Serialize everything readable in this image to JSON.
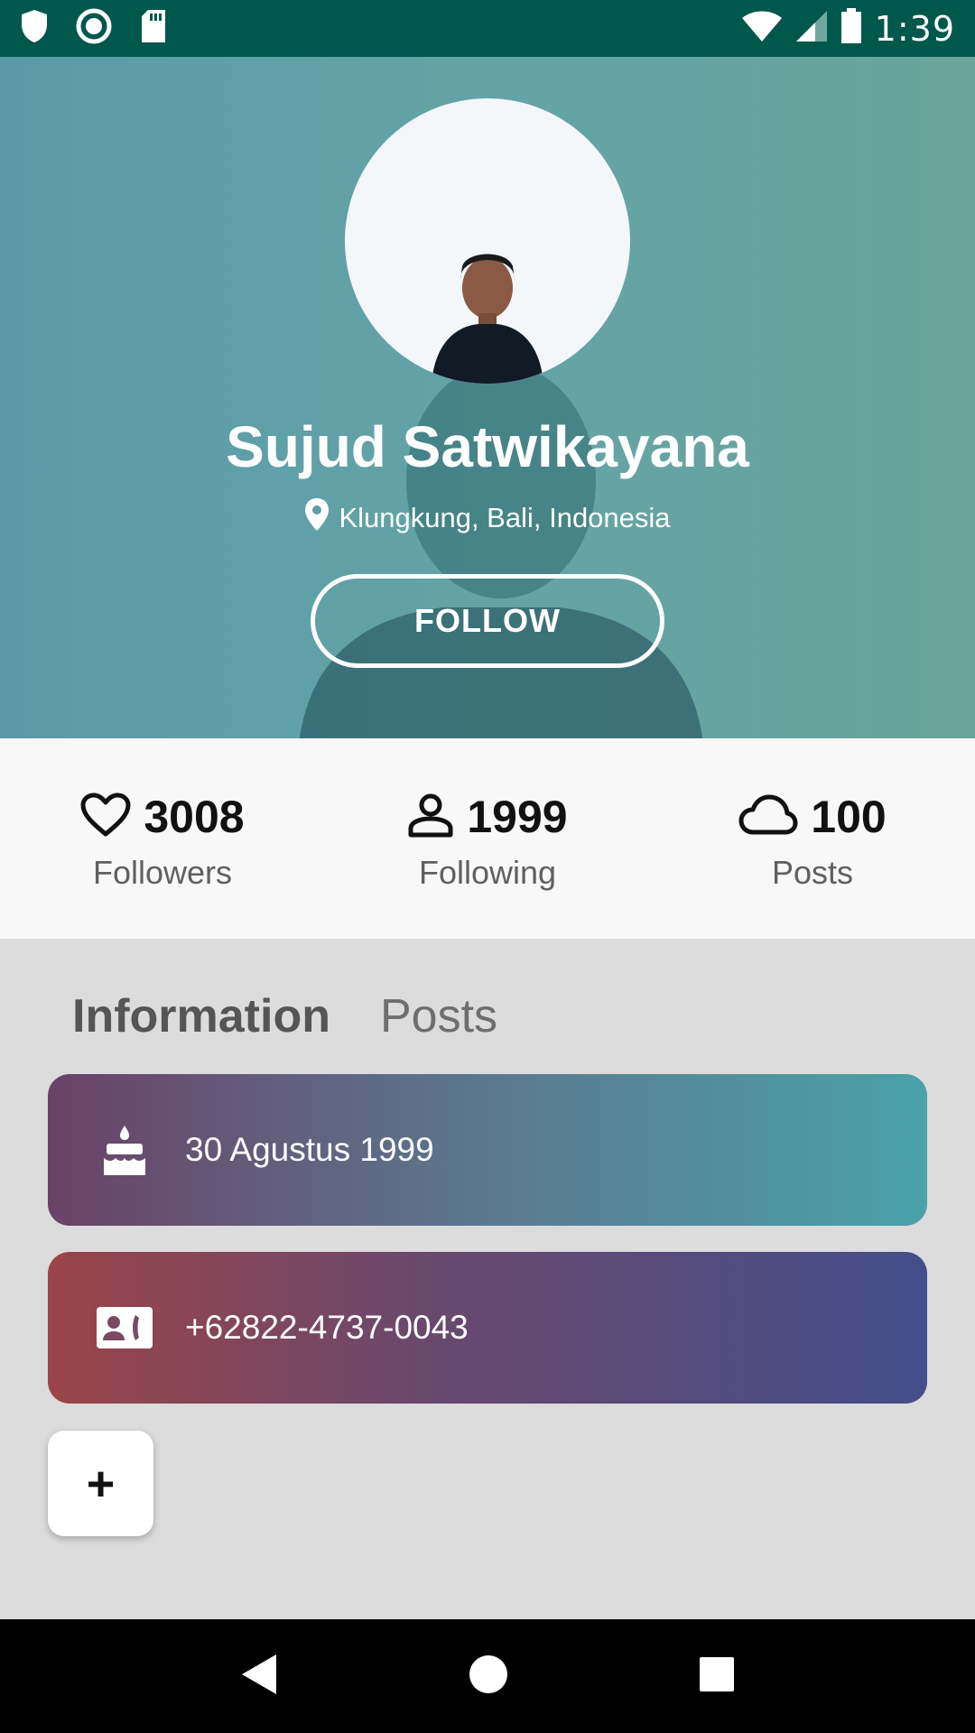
{
  "status_bar": {
    "time": "1:39",
    "left_icons": [
      "shield-icon",
      "circle-icon",
      "sd-card-icon"
    ],
    "right_icons": [
      "wifi-icon",
      "signal-icon",
      "battery-icon"
    ],
    "background": "#00574b"
  },
  "profile": {
    "name": "Sujud Satwikayana",
    "location": "Klungkung, Bali, Indonesia",
    "follow_label": "FOLLOW"
  },
  "stats": [
    {
      "icon": "heart-icon",
      "value": "3008",
      "label": "Followers"
    },
    {
      "icon": "person-icon",
      "value": "1999",
      "label": "Following"
    },
    {
      "icon": "cloud-icon",
      "value": "100",
      "label": "Posts"
    }
  ],
  "tabs": [
    {
      "label": "Information",
      "active": true
    },
    {
      "label": "Posts",
      "active": false
    }
  ],
  "info_cards": [
    {
      "icon": "cake-icon",
      "text": "30 Agustus 1999"
    },
    {
      "icon": "contact-phone-icon",
      "text": "+62822-4737-0043"
    }
  ],
  "add_button": {
    "label": "+"
  },
  "nav_bar": {
    "buttons": [
      "back-icon",
      "home-icon",
      "recents-icon"
    ]
  },
  "colors": {
    "header_gradient": [
      "#5a9aa8",
      "#6aa49a"
    ],
    "card_birthday": [
      "#6a4267",
      "#4aa2aa"
    ],
    "card_phone": [
      "#9b4449",
      "#444e8a"
    ]
  }
}
